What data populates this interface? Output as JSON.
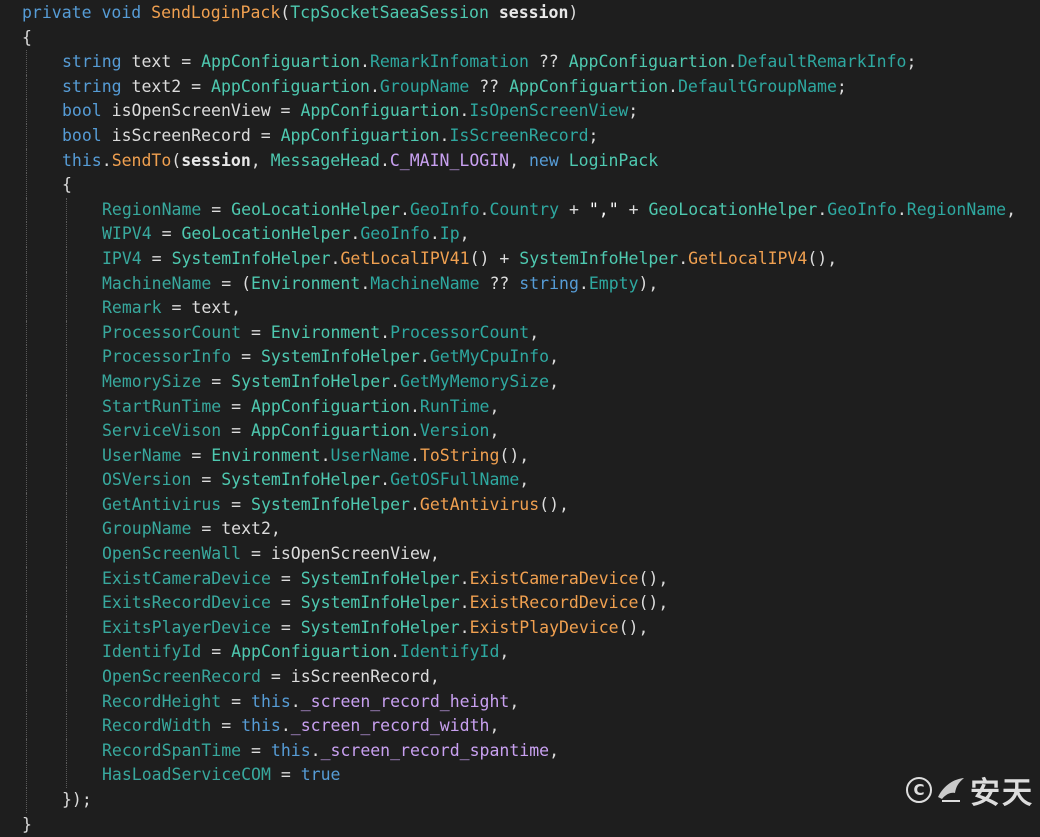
{
  "editor": {
    "lines": [
      {
        "indent": 0,
        "tokens": [
          [
            "private void ",
            "kw"
          ],
          [
            "SendLoginPack",
            "fn"
          ],
          [
            "(",
            "punc"
          ],
          [
            "TcpSocketSaeaSession",
            "type"
          ],
          [
            " ",
            "punc"
          ],
          [
            "session",
            "bold"
          ],
          [
            ")",
            "punc"
          ]
        ]
      },
      {
        "indent": 0,
        "tokens": [
          [
            "{",
            "punc"
          ]
        ]
      },
      {
        "indent": 1,
        "tokens": [
          [
            "string",
            "kw"
          ],
          [
            " text = ",
            "punc"
          ],
          [
            "AppConfiguartion",
            "type"
          ],
          [
            ".",
            "punc"
          ],
          [
            "RemarkInfomation",
            "mem"
          ],
          [
            " ?? ",
            "punc"
          ],
          [
            "AppConfiguartion",
            "type"
          ],
          [
            ".",
            "punc"
          ],
          [
            "DefaultRemarkInfo",
            "mem"
          ],
          [
            ";",
            "punc"
          ]
        ]
      },
      {
        "indent": 1,
        "tokens": [
          [
            "string",
            "kw"
          ],
          [
            " text2 = ",
            "punc"
          ],
          [
            "AppConfiguartion",
            "type"
          ],
          [
            ".",
            "punc"
          ],
          [
            "GroupName",
            "mem"
          ],
          [
            " ?? ",
            "punc"
          ],
          [
            "AppConfiguartion",
            "type"
          ],
          [
            ".",
            "punc"
          ],
          [
            "DefaultGroupName",
            "mem"
          ],
          [
            ";",
            "punc"
          ]
        ]
      },
      {
        "indent": 1,
        "tokens": [
          [
            "bool",
            "kw"
          ],
          [
            " isOpenScreenView = ",
            "punc"
          ],
          [
            "AppConfiguartion",
            "type"
          ],
          [
            ".",
            "punc"
          ],
          [
            "IsOpenScreenView",
            "mem"
          ],
          [
            ";",
            "punc"
          ]
        ]
      },
      {
        "indent": 1,
        "tokens": [
          [
            "bool",
            "kw"
          ],
          [
            " isScreenRecord = ",
            "punc"
          ],
          [
            "AppConfiguartion",
            "type"
          ],
          [
            ".",
            "punc"
          ],
          [
            "IsScreenRecord",
            "mem"
          ],
          [
            ";",
            "punc"
          ]
        ]
      },
      {
        "indent": 1,
        "tokens": [
          [
            "this",
            "kw"
          ],
          [
            ".",
            "punc"
          ],
          [
            "SendTo",
            "fn"
          ],
          [
            "(",
            "punc"
          ],
          [
            "session",
            "bold"
          ],
          [
            ", ",
            "punc"
          ],
          [
            "MessageHead",
            "type"
          ],
          [
            ".",
            "punc"
          ],
          [
            "C_MAIN_LOGIN",
            "fld"
          ],
          [
            ", ",
            "punc"
          ],
          [
            "new",
            "kw"
          ],
          [
            " ",
            "punc"
          ],
          [
            "LoginPack",
            "type"
          ]
        ]
      },
      {
        "indent": 1,
        "tokens": [
          [
            "{",
            "punc"
          ]
        ]
      },
      {
        "indent": 2,
        "tokens": [
          [
            "RegionName",
            "prop"
          ],
          [
            " = ",
            "punc"
          ],
          [
            "GeoLocationHelper",
            "type"
          ],
          [
            ".",
            "punc"
          ],
          [
            "GeoInfo",
            "mem"
          ],
          [
            ".",
            "punc"
          ],
          [
            "Country",
            "mem"
          ],
          [
            " + ",
            "punc"
          ],
          [
            "\",\"",
            "str"
          ],
          [
            " + ",
            "punc"
          ],
          [
            "GeoLocationHelper",
            "type"
          ],
          [
            ".",
            "punc"
          ],
          [
            "GeoInfo",
            "mem"
          ],
          [
            ".",
            "punc"
          ],
          [
            "RegionName",
            "mem"
          ],
          [
            ",",
            "punc"
          ]
        ]
      },
      {
        "indent": 2,
        "tokens": [
          [
            "WIPV4",
            "prop"
          ],
          [
            " = ",
            "punc"
          ],
          [
            "GeoLocationHelper",
            "type"
          ],
          [
            ".",
            "punc"
          ],
          [
            "GeoInfo",
            "mem"
          ],
          [
            ".",
            "punc"
          ],
          [
            "Ip",
            "mem"
          ],
          [
            ",",
            "punc"
          ]
        ]
      },
      {
        "indent": 2,
        "tokens": [
          [
            "IPV4",
            "prop"
          ],
          [
            " = ",
            "punc"
          ],
          [
            "SystemInfoHelper",
            "type"
          ],
          [
            ".",
            "punc"
          ],
          [
            "GetLocalIPV41",
            "fn"
          ],
          [
            "() + ",
            "punc"
          ],
          [
            "SystemInfoHelper",
            "type"
          ],
          [
            ".",
            "punc"
          ],
          [
            "GetLocalIPV4",
            "fn"
          ],
          [
            "(),",
            "punc"
          ]
        ]
      },
      {
        "indent": 2,
        "tokens": [
          [
            "MachineName",
            "prop"
          ],
          [
            " = (",
            "punc"
          ],
          [
            "Environment",
            "type"
          ],
          [
            ".",
            "punc"
          ],
          [
            "MachineName",
            "mem"
          ],
          [
            " ?? ",
            "punc"
          ],
          [
            "string",
            "kw"
          ],
          [
            ".",
            "punc"
          ],
          [
            "Empty",
            "mem"
          ],
          [
            "),",
            "punc"
          ]
        ]
      },
      {
        "indent": 2,
        "tokens": [
          [
            "Remark",
            "prop"
          ],
          [
            " = text,",
            "punc"
          ]
        ]
      },
      {
        "indent": 2,
        "tokens": [
          [
            "ProcessorCount",
            "prop"
          ],
          [
            " = ",
            "punc"
          ],
          [
            "Environment",
            "type"
          ],
          [
            ".",
            "punc"
          ],
          [
            "ProcessorCount",
            "mem"
          ],
          [
            ",",
            "punc"
          ]
        ]
      },
      {
        "indent": 2,
        "tokens": [
          [
            "ProcessorInfo",
            "prop"
          ],
          [
            " = ",
            "punc"
          ],
          [
            "SystemInfoHelper",
            "type"
          ],
          [
            ".",
            "punc"
          ],
          [
            "GetMyCpuInfo",
            "mem"
          ],
          [
            ",",
            "punc"
          ]
        ]
      },
      {
        "indent": 2,
        "tokens": [
          [
            "MemorySize",
            "prop"
          ],
          [
            " = ",
            "punc"
          ],
          [
            "SystemInfoHelper",
            "type"
          ],
          [
            ".",
            "punc"
          ],
          [
            "GetMyMemorySize",
            "mem"
          ],
          [
            ",",
            "punc"
          ]
        ]
      },
      {
        "indent": 2,
        "tokens": [
          [
            "StartRunTime",
            "prop"
          ],
          [
            " = ",
            "punc"
          ],
          [
            "AppConfiguartion",
            "type"
          ],
          [
            ".",
            "punc"
          ],
          [
            "RunTime",
            "mem"
          ],
          [
            ",",
            "punc"
          ]
        ]
      },
      {
        "indent": 2,
        "tokens": [
          [
            "ServiceVison",
            "prop"
          ],
          [
            " = ",
            "punc"
          ],
          [
            "AppConfiguartion",
            "type"
          ],
          [
            ".",
            "punc"
          ],
          [
            "Version",
            "mem"
          ],
          [
            ",",
            "punc"
          ]
        ]
      },
      {
        "indent": 2,
        "tokens": [
          [
            "UserName",
            "prop"
          ],
          [
            " = ",
            "punc"
          ],
          [
            "Environment",
            "type"
          ],
          [
            ".",
            "punc"
          ],
          [
            "UserName",
            "mem"
          ],
          [
            ".",
            "punc"
          ],
          [
            "ToString",
            "fn"
          ],
          [
            "(),",
            "punc"
          ]
        ]
      },
      {
        "indent": 2,
        "tokens": [
          [
            "OSVersion",
            "prop"
          ],
          [
            " = ",
            "punc"
          ],
          [
            "SystemInfoHelper",
            "type"
          ],
          [
            ".",
            "punc"
          ],
          [
            "GetOSFullName",
            "mem"
          ],
          [
            ",",
            "punc"
          ]
        ]
      },
      {
        "indent": 2,
        "tokens": [
          [
            "GetAntivirus",
            "prop"
          ],
          [
            " = ",
            "punc"
          ],
          [
            "SystemInfoHelper",
            "type"
          ],
          [
            ".",
            "punc"
          ],
          [
            "GetAntivirus",
            "fn"
          ],
          [
            "(),",
            "punc"
          ]
        ]
      },
      {
        "indent": 2,
        "tokens": [
          [
            "GroupName",
            "prop"
          ],
          [
            " = text2,",
            "punc"
          ]
        ]
      },
      {
        "indent": 2,
        "tokens": [
          [
            "OpenScreenWall",
            "prop"
          ],
          [
            " = isOpenScreenView,",
            "punc"
          ]
        ]
      },
      {
        "indent": 2,
        "tokens": [
          [
            "ExistCameraDevice",
            "prop"
          ],
          [
            " = ",
            "punc"
          ],
          [
            "SystemInfoHelper",
            "type"
          ],
          [
            ".",
            "punc"
          ],
          [
            "ExistCameraDevice",
            "fn"
          ],
          [
            "(),",
            "punc"
          ]
        ]
      },
      {
        "indent": 2,
        "tokens": [
          [
            "ExitsRecordDevice",
            "prop"
          ],
          [
            " = ",
            "punc"
          ],
          [
            "SystemInfoHelper",
            "type"
          ],
          [
            ".",
            "punc"
          ],
          [
            "ExistRecordDevice",
            "fn"
          ],
          [
            "(),",
            "punc"
          ]
        ]
      },
      {
        "indent": 2,
        "tokens": [
          [
            "ExitsPlayerDevice",
            "prop"
          ],
          [
            " = ",
            "punc"
          ],
          [
            "SystemInfoHelper",
            "type"
          ],
          [
            ".",
            "punc"
          ],
          [
            "ExistPlayDevice",
            "fn"
          ],
          [
            "(),",
            "punc"
          ]
        ]
      },
      {
        "indent": 2,
        "tokens": [
          [
            "IdentifyId",
            "prop"
          ],
          [
            " = ",
            "punc"
          ],
          [
            "AppConfiguartion",
            "type"
          ],
          [
            ".",
            "punc"
          ],
          [
            "IdentifyId",
            "mem"
          ],
          [
            ",",
            "punc"
          ]
        ]
      },
      {
        "indent": 2,
        "tokens": [
          [
            "OpenScreenRecord",
            "prop"
          ],
          [
            " = isScreenRecord,",
            "punc"
          ]
        ]
      },
      {
        "indent": 2,
        "tokens": [
          [
            "RecordHeight",
            "prop"
          ],
          [
            " = ",
            "punc"
          ],
          [
            "this",
            "kw"
          ],
          [
            ".",
            "punc"
          ],
          [
            "_screen_record_height",
            "fld"
          ],
          [
            ",",
            "punc"
          ]
        ]
      },
      {
        "indent": 2,
        "tokens": [
          [
            "RecordWidth",
            "prop"
          ],
          [
            " = ",
            "punc"
          ],
          [
            "this",
            "kw"
          ],
          [
            ".",
            "punc"
          ],
          [
            "_screen_record_width",
            "fld"
          ],
          [
            ",",
            "punc"
          ]
        ]
      },
      {
        "indent": 2,
        "tokens": [
          [
            "RecordSpanTime",
            "prop"
          ],
          [
            " = ",
            "punc"
          ],
          [
            "this",
            "kw"
          ],
          [
            ".",
            "punc"
          ],
          [
            "_screen_record_spantime",
            "fld"
          ],
          [
            ",",
            "punc"
          ]
        ]
      },
      {
        "indent": 2,
        "tokens": [
          [
            "HasLoadServiceCOM",
            "prop"
          ],
          [
            " = ",
            "punc"
          ],
          [
            "true",
            "kw"
          ]
        ]
      },
      {
        "indent": 1,
        "tokens": [
          [
            "});",
            "punc"
          ]
        ]
      },
      {
        "indent": 0,
        "tokens": [
          [
            "}",
            "punc"
          ]
        ]
      }
    ]
  },
  "watermark": {
    "symbol": "C",
    "text": "安天",
    "icon": "bird-logo-icon"
  }
}
